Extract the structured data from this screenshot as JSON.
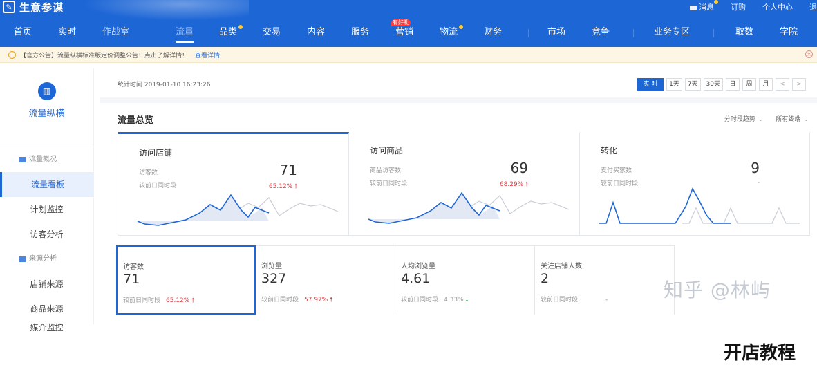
{
  "app": {
    "logo_icon": "edit-icon",
    "name": "生意参谋"
  },
  "user_links": [
    "消息",
    "订购",
    "个人中心",
    "退"
  ],
  "nav": {
    "items": [
      "首页",
      "实时",
      "作战室",
      "流量",
      "品类",
      "交易",
      "内容",
      "服务",
      "营销",
      "物流",
      "财务",
      "市场",
      "竞争",
      "业务专区",
      "取数",
      "学院"
    ],
    "active": "流量",
    "badge_text": "有好礼",
    "dot_items": [
      "品类",
      "物流"
    ]
  },
  "notice": {
    "text": "【官方公告】流量纵横标准版定价调整公告！点击了解详情！",
    "link": "查看详情"
  },
  "sidebar": {
    "title": "流量纵横",
    "icon": "chart-icon",
    "groups": [
      {
        "label": "流量概况",
        "items": [
          "流量看板",
          "计划监控",
          "访客分析"
        ]
      },
      {
        "label": "来源分析",
        "items": [
          "店铺来源",
          "商品来源",
          "媒介监控"
        ]
      }
    ],
    "active_item": "流量看板"
  },
  "stat_time": "统计时间 2019-01-10 16:23:26",
  "periods": [
    "实 时",
    "1天",
    "7天",
    "30天",
    "日",
    "周",
    "月",
    "<",
    ">"
  ],
  "selected_period": "实 时",
  "overview": {
    "title": "流量总览",
    "controls": [
      "分时段趋势",
      "所有终端"
    ],
    "cards": [
      {
        "title": "访问店铺",
        "label1": "访客数",
        "label2": "较前日同时段",
        "value": "71",
        "change": "65.12%",
        "direction": "up"
      },
      {
        "title": "访问商品",
        "label1": "商品访客数",
        "label2": "较前日同时段",
        "value": "69",
        "change": "68.29%",
        "direction": "up"
      },
      {
        "title": "转化",
        "label1": "支付买家数",
        "label2": "较前日同时段",
        "value": "9",
        "change": "-",
        "direction": "none"
      }
    ],
    "metrics": [
      {
        "label": "访客数",
        "value": "71",
        "cmp": "较前日同时段",
        "change": "65.12%",
        "direction": "up"
      },
      {
        "label": "浏览量",
        "value": "327",
        "cmp": "较前日同时段",
        "change": "57.97%",
        "direction": "up"
      },
      {
        "label": "人均浏览量",
        "value": "4.61",
        "cmp": "较前日同时段",
        "change": "4.33%",
        "direction": "down"
      },
      {
        "label": "关注店铺人数",
        "value": "2",
        "cmp": "较前日同时段",
        "change": "-",
        "direction": "none"
      }
    ]
  },
  "watermark": "知乎 @林屿",
  "caption": "开店教程",
  "colors": {
    "primary": "#1d66d6",
    "up": "#e0393e",
    "down": "#2ea84a",
    "notice_bg": "#fdf6e4"
  }
}
